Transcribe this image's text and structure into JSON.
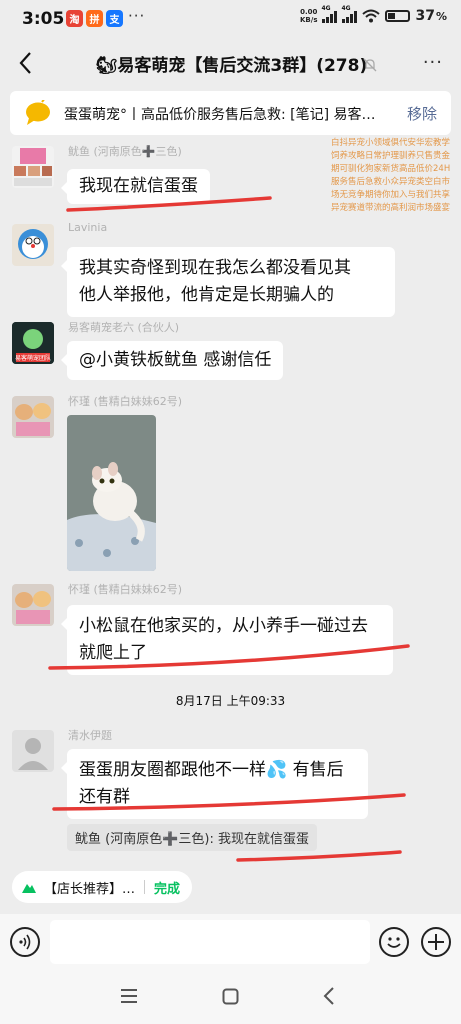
{
  "status": {
    "time": "3:05",
    "more": "···",
    "net_speed_top": "0.00",
    "net_speed_bottom": "KB/s",
    "signal_tag": "4G",
    "battery": "37"
  },
  "header": {
    "title": "🐿易客萌宠【售后交流3群】(278)",
    "more": "···"
  },
  "pinned": {
    "text": "蛋蛋萌宠°丨高品低价服务售后急救: [笔记] 易客…",
    "remove": "移除"
  },
  "ad_overlay": "白抖异宠小领域俱代安华宏教学饲养攻略日常护理驯养只售贵金期可驯化狗家新货高品低价24H服务售后急救小众异宠类空白市场无竞争期待你加入与我们共享异宠赛道带流的高利润市场盛宴",
  "messages": [
    {
      "sender": "鱿鱼 (河南原色➕三色)",
      "text": "我现在就信蛋蛋"
    },
    {
      "sender": "Lavinia",
      "text_line1": "我其实奇怪到现在我怎么都没看见其",
      "text_line2": "他人举报他，他肯定是长期骗人的"
    },
    {
      "sender": "易客萌宠老六 (合伙人)",
      "text": "@小黄铁板鱿鱼  感谢信任",
      "avatar_label": "易客萌宠团队"
    },
    {
      "sender": "怀瑾 (售精白妹妹62号)"
    },
    {
      "sender": "怀瑾 (售精白妹妹62号)",
      "text_line1": "小松鼠在他家买的，从小养手一碰过去",
      "text_line2": "就爬上了"
    }
  ],
  "time_separator": "8月17日 上午09:33",
  "last_message": {
    "sender": "清水伊题",
    "text_line1": "蛋蛋朋友圈都跟他不一样💦 有售后",
    "text_line2": "还有群",
    "quote": "鱿鱼 (河南原色➕三色): 我现在就信蛋蛋"
  },
  "chip": {
    "label": "【店长推荐】…",
    "done": "完成"
  },
  "colors": {
    "annotation_red": "#e53935",
    "wechat_green": "#07c160",
    "link_blue": "#576b95"
  }
}
